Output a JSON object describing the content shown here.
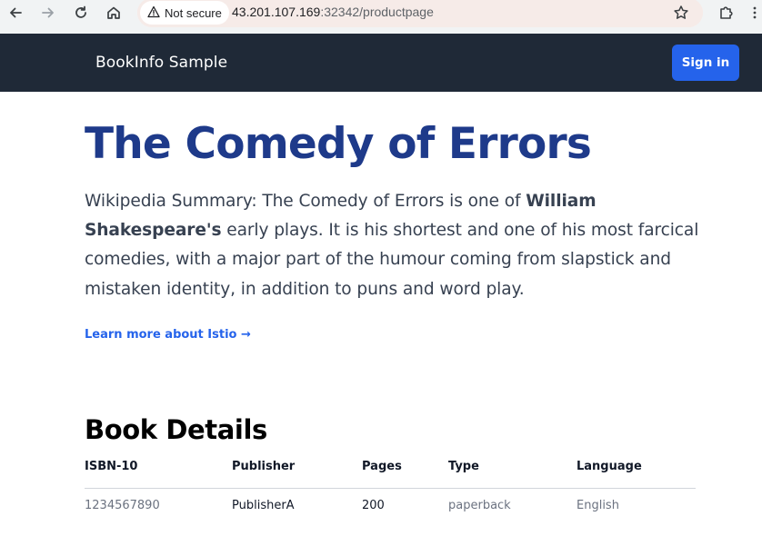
{
  "browser": {
    "security_label": "Not secure",
    "url_host": "43.201.107.169",
    "url_rest": ":32342/productpage",
    "icons": [
      "back-arrow-icon",
      "forward-arrow-icon",
      "reload-icon",
      "home-icon",
      "warning-triangle-icon",
      "star-icon",
      "extensions-puzzle-icon"
    ]
  },
  "header": {
    "brand": "BookInfo Sample",
    "signin_label": "Sign in"
  },
  "main": {
    "title": "The Comedy of Errors",
    "summary_before": "Wikipedia Summary: The Comedy of Errors is one of ",
    "summary_bold": "William Shakespeare's",
    "summary_after": " early plays. It is his shortest and one of his most farcical comedies, with a major part of the humour coming from slapstick and mistaken identity, in addition to puns and word play.",
    "learn_more": "Learn more about Istio →"
  },
  "details": {
    "heading": "Book Details",
    "columns": [
      "ISBN-10",
      "Publisher",
      "Pages",
      "Type",
      "Language"
    ],
    "row": [
      "1234567890",
      "PublisherA",
      "200",
      "paperback",
      "English"
    ]
  },
  "colors": {
    "header_bg": "#1f2937",
    "accent": "#2563eb",
    "title": "#1e3a8a"
  }
}
